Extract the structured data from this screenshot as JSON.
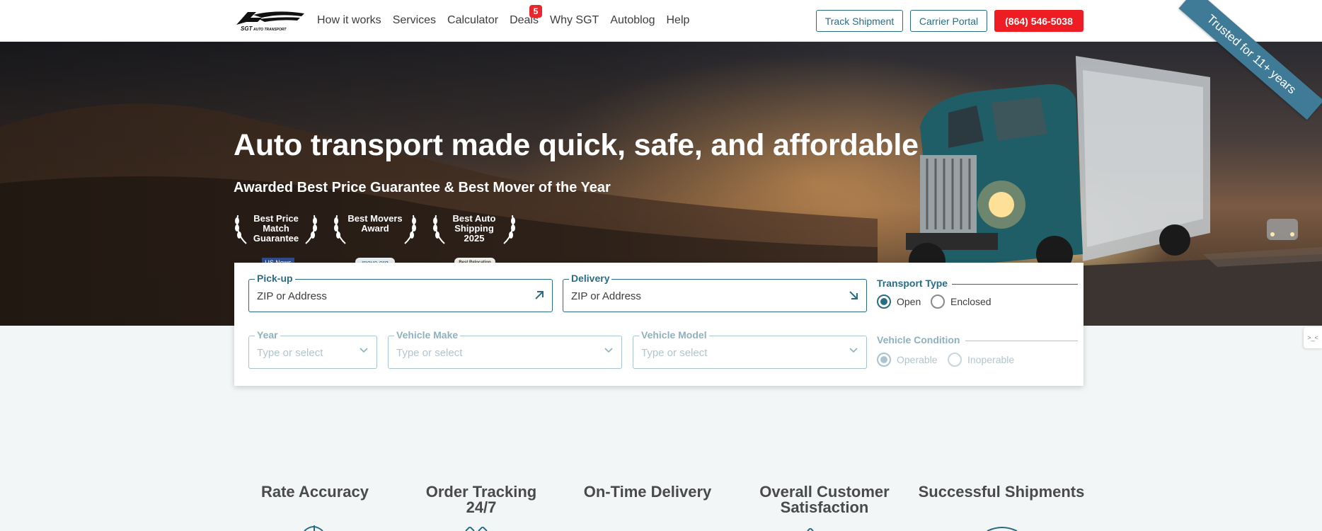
{
  "nav": {
    "logo_alt": "SGT AUTO TRANSPORT",
    "links": [
      {
        "label": "How it works"
      },
      {
        "label": "Services"
      },
      {
        "label": "Calculator"
      },
      {
        "label": "Deals",
        "badge": "5"
      },
      {
        "label": "Why SGT"
      },
      {
        "label": "Autoblog"
      },
      {
        "label": "Help"
      }
    ],
    "track_label": "Track Shipment",
    "carrier_label": "Carrier Portal",
    "phone_label": "(864) 546-5038"
  },
  "hero": {
    "title": "Auto transport made quick, safe, and affordable",
    "subtitle": "Awarded Best Price Guarantee & Best Mover of the Year",
    "ribbon": "Trusted for 11+ years",
    "awards": [
      {
        "text": "Best Price Match Guarantee",
        "source": "US.News"
      },
      {
        "text": "Best Movers Award",
        "source": "move.org"
      },
      {
        "text": "Best Auto Shipping 2025",
        "source": "Best Relocation"
      }
    ]
  },
  "form": {
    "pickup": {
      "label": "Pick-up",
      "value": "ZIP or Address"
    },
    "delivery": {
      "label": "Delivery",
      "value": "ZIP or Address"
    },
    "transport_type": {
      "label": "Transport Type",
      "options": [
        "Open",
        "Enclosed"
      ],
      "selected": "Open"
    },
    "year": {
      "label": "Year",
      "placeholder": "Type or select"
    },
    "make": {
      "label": "Vehicle Make",
      "placeholder": "Type or select"
    },
    "model": {
      "label": "Vehicle Model",
      "placeholder": "Type or select"
    },
    "vehicle_condition": {
      "label": "Vehicle Condition",
      "options": [
        "Operable",
        "Inoperable"
      ],
      "selected": "Operable"
    }
  },
  "stats": [
    {
      "label": "Rate Accuracy"
    },
    {
      "label": "Order Tracking 24/7"
    },
    {
      "label": "On-Time Delivery"
    },
    {
      "label": "Overall Customer Satisfaction"
    },
    {
      "label": "Successful Shipments"
    }
  ],
  "side_tab": {
    "label": ">_<"
  },
  "colors": {
    "primary": "#2b6c85",
    "accent_red": "#ee1d23",
    "badge_red": "#e8262d",
    "page_bg": "#f3f6f7"
  }
}
